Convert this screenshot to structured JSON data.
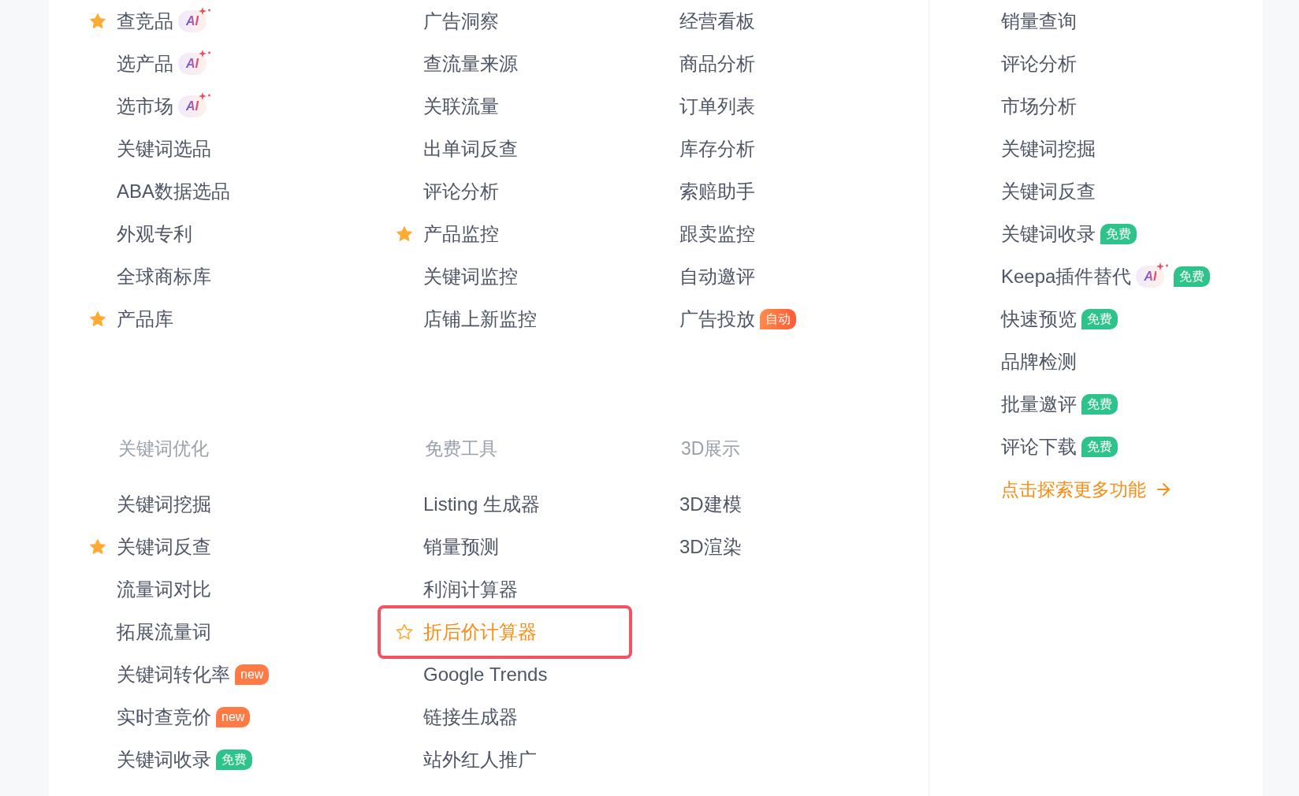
{
  "columns": [
    {
      "groups": [
        {
          "items": [
            {
              "label": "查竞品",
              "starred": true,
              "highlighted": false,
              "badges": [
                {
                  "kind": "ai",
                  "text": "AI"
                }
              ]
            },
            {
              "label": "选产品",
              "starred": false,
              "highlighted": false,
              "badges": [
                {
                  "kind": "ai",
                  "text": "AI"
                }
              ]
            },
            {
              "label": "选市场",
              "starred": false,
              "highlighted": false,
              "badges": [
                {
                  "kind": "ai",
                  "text": "AI"
                }
              ]
            },
            {
              "label": "关键词选品",
              "starred": false,
              "highlighted": false
            },
            {
              "label": "ABA数据选品",
              "starred": false,
              "highlighted": false
            },
            {
              "label": "外观专利",
              "starred": false,
              "highlighted": false
            },
            {
              "label": "全球商标库",
              "starred": false,
              "highlighted": false
            },
            {
              "label": "产品库",
              "starred": true,
              "highlighted": false
            }
          ]
        },
        {
          "title": "关键词优化",
          "items": [
            {
              "label": "关键词挖掘",
              "starred": false,
              "highlighted": false
            },
            {
              "label": "关键词反查",
              "starred": true,
              "highlighted": false
            },
            {
              "label": "流量词对比",
              "starred": false,
              "highlighted": false
            },
            {
              "label": "拓展流量词",
              "starred": false,
              "highlighted": false
            },
            {
              "label": "关键词转化率",
              "starred": false,
              "highlighted": false,
              "badges": [
                {
                  "kind": "new",
                  "text": "new"
                }
              ]
            },
            {
              "label": "实时查竞价",
              "starred": false,
              "highlighted": false,
              "badges": [
                {
                  "kind": "new",
                  "text": "new"
                }
              ]
            },
            {
              "label": "关键词收录",
              "starred": false,
              "highlighted": false,
              "badges": [
                {
                  "kind": "free",
                  "text": "免费"
                }
              ]
            }
          ]
        }
      ]
    },
    {
      "groups": [
        {
          "items": [
            {
              "label": "广告洞察",
              "starred": false,
              "highlighted": false
            },
            {
              "label": "查流量来源",
              "starred": false,
              "highlighted": false
            },
            {
              "label": "关联流量",
              "starred": false,
              "highlighted": false
            },
            {
              "label": "出单词反查",
              "starred": false,
              "highlighted": false
            },
            {
              "label": "评论分析",
              "starred": false,
              "highlighted": false
            },
            {
              "label": "产品监控",
              "starred": true,
              "highlighted": false
            },
            {
              "label": "关键词监控",
              "starred": false,
              "highlighted": false
            },
            {
              "label": "店铺上新监控",
              "starred": false,
              "highlighted": false
            }
          ]
        },
        {
          "title": "免费工具",
          "items": [
            {
              "label": "Listing 生成器",
              "starred": false,
              "highlighted": false
            },
            {
              "label": "销量预测",
              "starred": false,
              "highlighted": false
            },
            {
              "label": "利润计算器",
              "starred": false,
              "highlighted": false
            },
            {
              "label": "折后价计算器",
              "starred": false,
              "highlighted": true
            },
            {
              "label": "Google Trends",
              "starred": false,
              "highlighted": false
            },
            {
              "label": "链接生成器",
              "starred": false,
              "highlighted": false
            },
            {
              "label": "站外红人推广",
              "starred": false,
              "highlighted": false
            }
          ]
        }
      ]
    },
    {
      "groups": [
        {
          "items": [
            {
              "label": "经营看板",
              "starred": false,
              "highlighted": false
            },
            {
              "label": "商品分析",
              "starred": false,
              "highlighted": false
            },
            {
              "label": "订单列表",
              "starred": false,
              "highlighted": false
            },
            {
              "label": "库存分析",
              "starred": false,
              "highlighted": false
            },
            {
              "label": "索赔助手",
              "starred": false,
              "highlighted": false
            },
            {
              "label": "跟卖监控",
              "starred": false,
              "highlighted": false
            },
            {
              "label": "自动邀评",
              "starred": false,
              "highlighted": false
            },
            {
              "label": "广告投放",
              "starred": false,
              "highlighted": false,
              "badges": [
                {
                  "kind": "auto",
                  "text": "自动"
                }
              ]
            }
          ]
        },
        {
          "title": "3D展示",
          "items": [
            {
              "label": "3D建模",
              "starred": false,
              "highlighted": false
            },
            {
              "label": "3D渲染",
              "starred": false,
              "highlighted": false
            }
          ]
        }
      ]
    }
  ],
  "side_panel": {
    "items": [
      {
        "label": "销量查询",
        "starred": false,
        "highlighted": false
      },
      {
        "label": "评论分析",
        "starred": false,
        "highlighted": false
      },
      {
        "label": "市场分析",
        "starred": false,
        "highlighted": false
      },
      {
        "label": "关键词挖掘",
        "starred": false,
        "highlighted": false
      },
      {
        "label": "关键词反查",
        "starred": false,
        "highlighted": false
      },
      {
        "label": "关键词收录",
        "starred": false,
        "highlighted": false,
        "badges": [
          {
            "kind": "free",
            "text": "免费"
          }
        ]
      },
      {
        "label": "Keepa插件替代",
        "starred": false,
        "highlighted": false,
        "badges": [
          {
            "kind": "ai",
            "text": "AI"
          },
          {
            "kind": "free",
            "text": "免费"
          }
        ]
      },
      {
        "label": "快速预览",
        "starred": false,
        "highlighted": false,
        "badges": [
          {
            "kind": "free",
            "text": "免费"
          }
        ]
      },
      {
        "label": "品牌检测",
        "starred": false,
        "highlighted": false
      },
      {
        "label": "批量邀评",
        "starred": false,
        "highlighted": false,
        "badges": [
          {
            "kind": "free",
            "text": "免费"
          }
        ]
      },
      {
        "label": "评论下载",
        "starred": false,
        "highlighted": false,
        "badges": [
          {
            "kind": "free",
            "text": "免费"
          }
        ]
      }
    ],
    "more_link": {
      "text": "点击探索更多功能"
    }
  }
}
